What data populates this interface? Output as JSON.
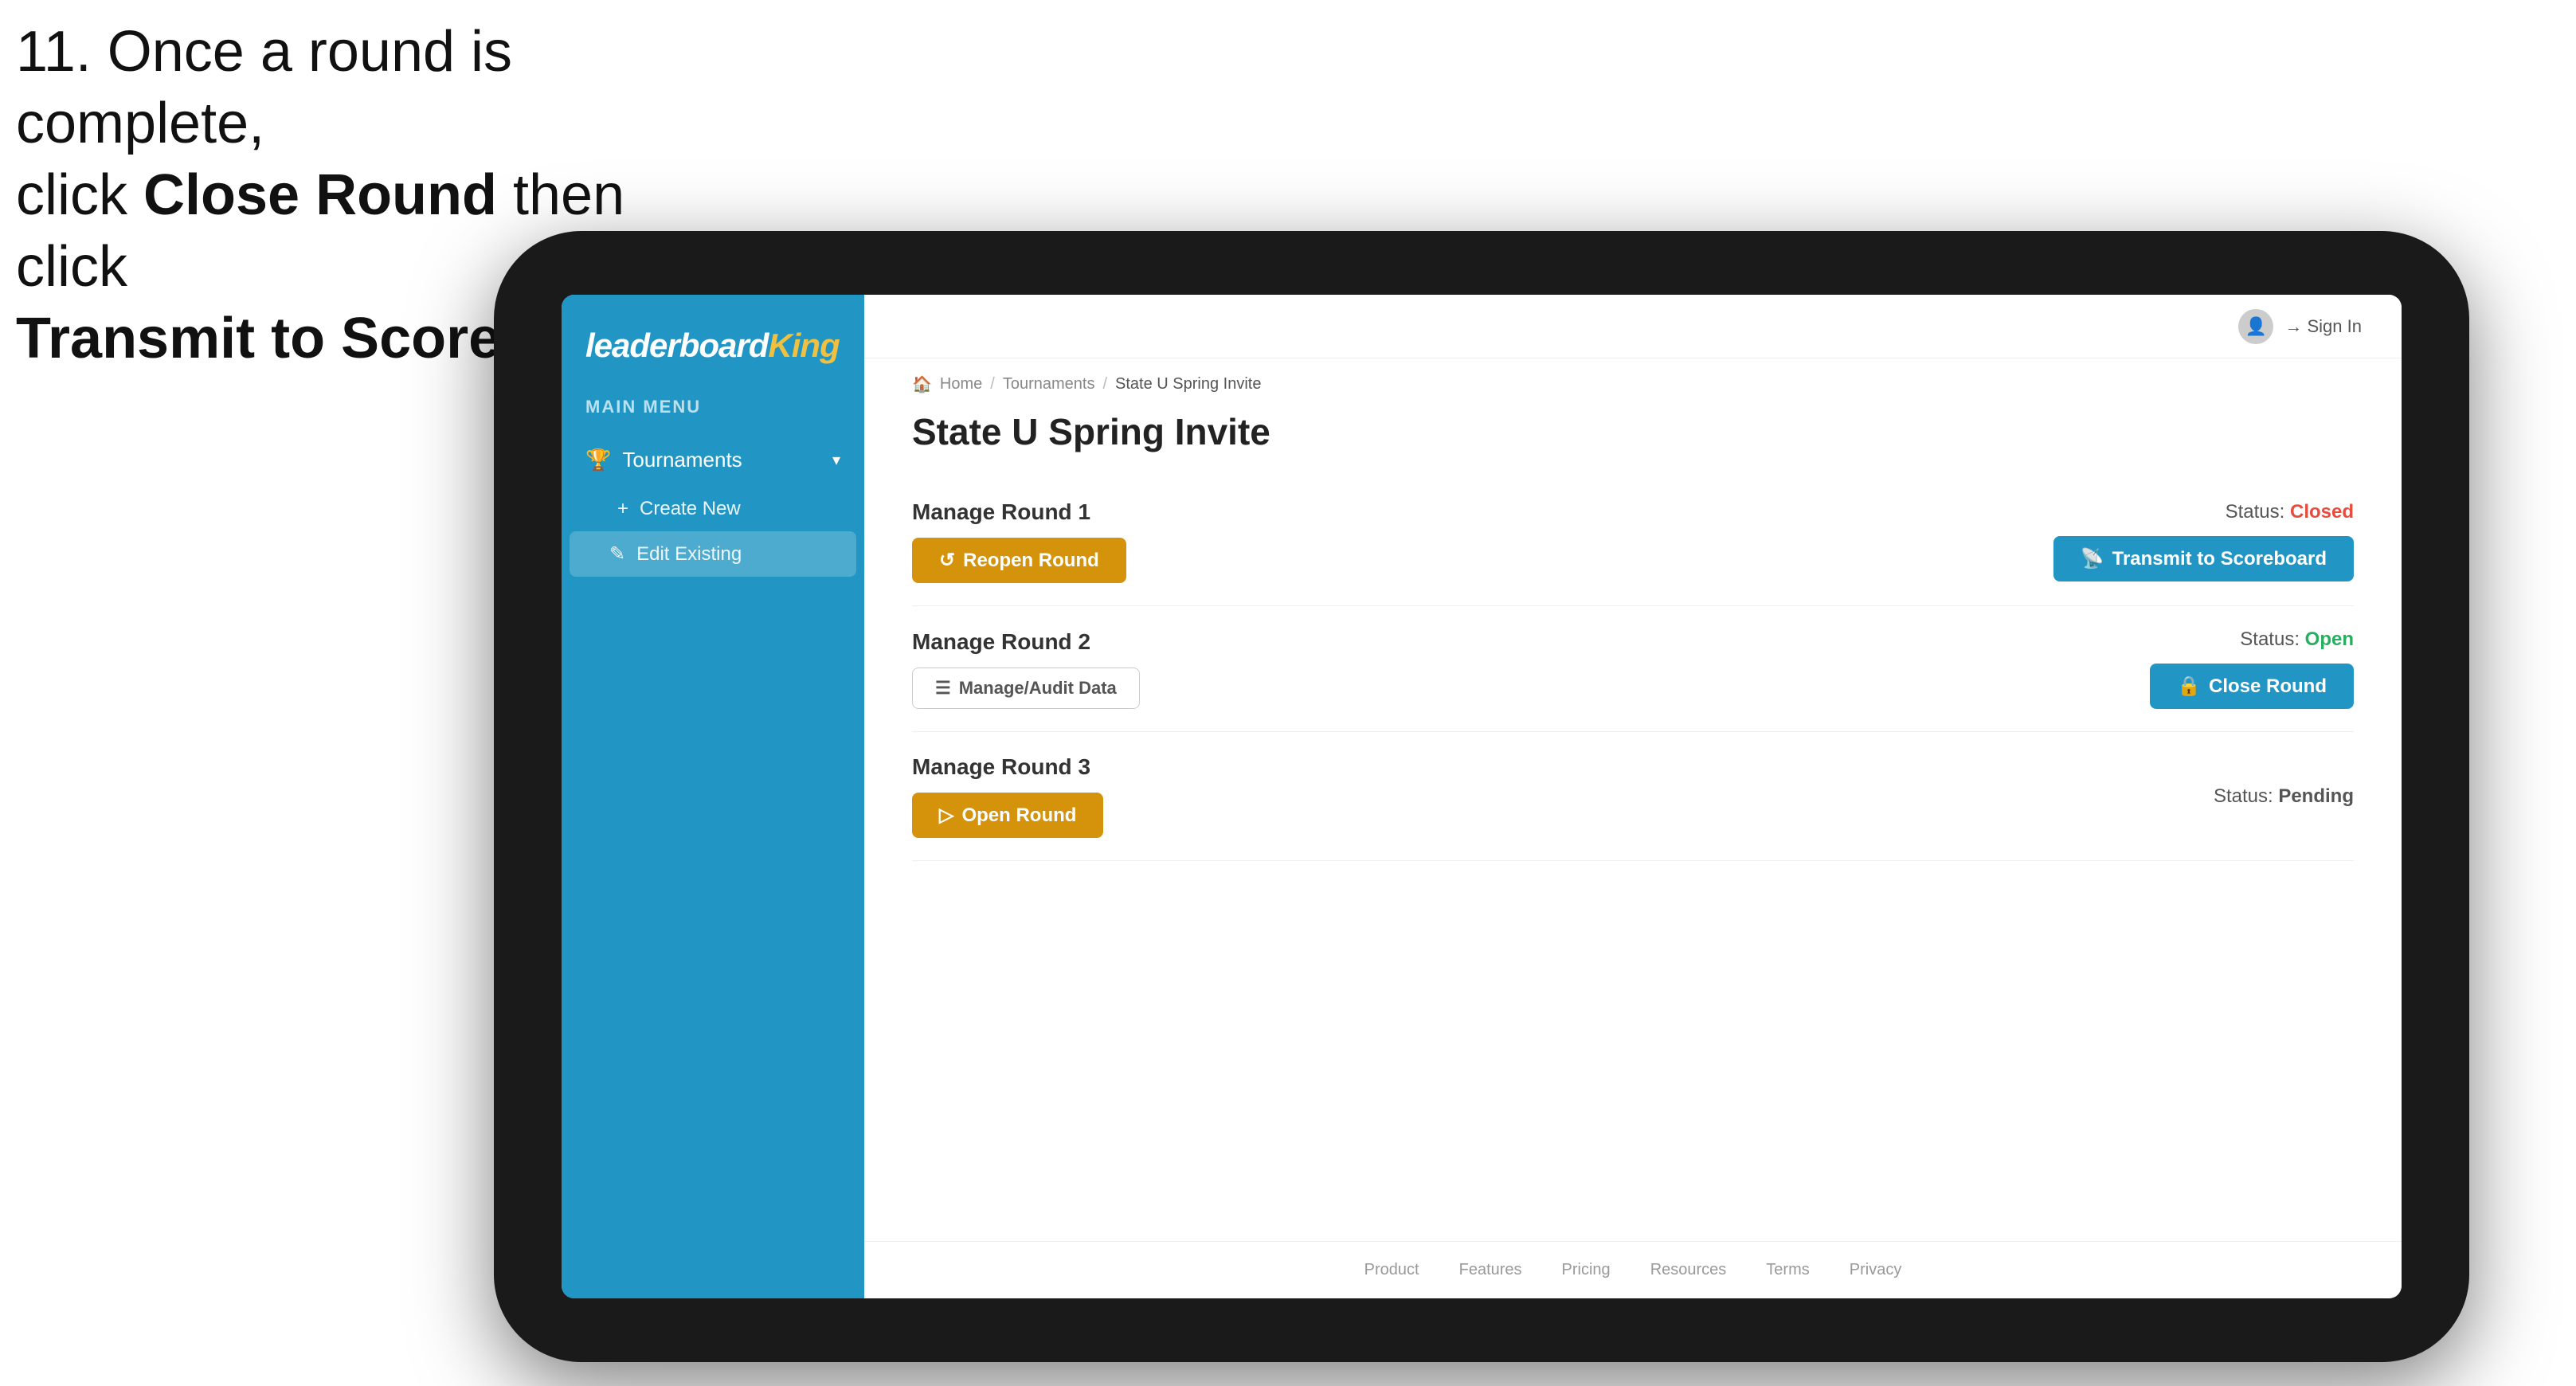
{
  "instruction": {
    "line1": "11. Once a round is complete,",
    "line2_prefix": "click ",
    "line2_bold": "Close Round",
    "line2_suffix": " then click",
    "line3_bold": "Transmit to Scoreboard."
  },
  "sidebar": {
    "logo_leaderboard": "leaderboard",
    "logo_king": "King",
    "main_menu_label": "MAIN MENU",
    "tournaments_label": "Tournaments",
    "create_new_label": "Create New",
    "edit_existing_label": "Edit Existing"
  },
  "topnav": {
    "sign_in_label": "Sign In"
  },
  "breadcrumb": {
    "home": "Home",
    "tournaments": "Tournaments",
    "current": "State U Spring Invite"
  },
  "page": {
    "title": "State U Spring Invite"
  },
  "rounds": [
    {
      "id": "round1",
      "title": "Manage Round 1",
      "status_label": "Status:",
      "status_value": "Closed",
      "status_class": "status-closed",
      "left_button": "Reopen Round",
      "left_button_style": "btn-gold",
      "right_button": "Transmit to Scoreboard",
      "right_button_style": "btn-blue"
    },
    {
      "id": "round2",
      "title": "Manage Round 2",
      "status_label": "Status:",
      "status_value": "Open",
      "status_class": "status-open",
      "left_button": "Manage/Audit Data",
      "left_button_style": "btn-manage",
      "right_button": "Close Round",
      "right_button_style": "btn-blue"
    },
    {
      "id": "round3",
      "title": "Manage Round 3",
      "status_label": "Status:",
      "status_value": "Pending",
      "status_class": "status-pending",
      "left_button": "Open Round",
      "left_button_style": "btn-gold",
      "right_button": null,
      "right_button_style": null
    }
  ],
  "footer": {
    "links": [
      "Product",
      "Features",
      "Pricing",
      "Resources",
      "Terms",
      "Privacy"
    ]
  }
}
